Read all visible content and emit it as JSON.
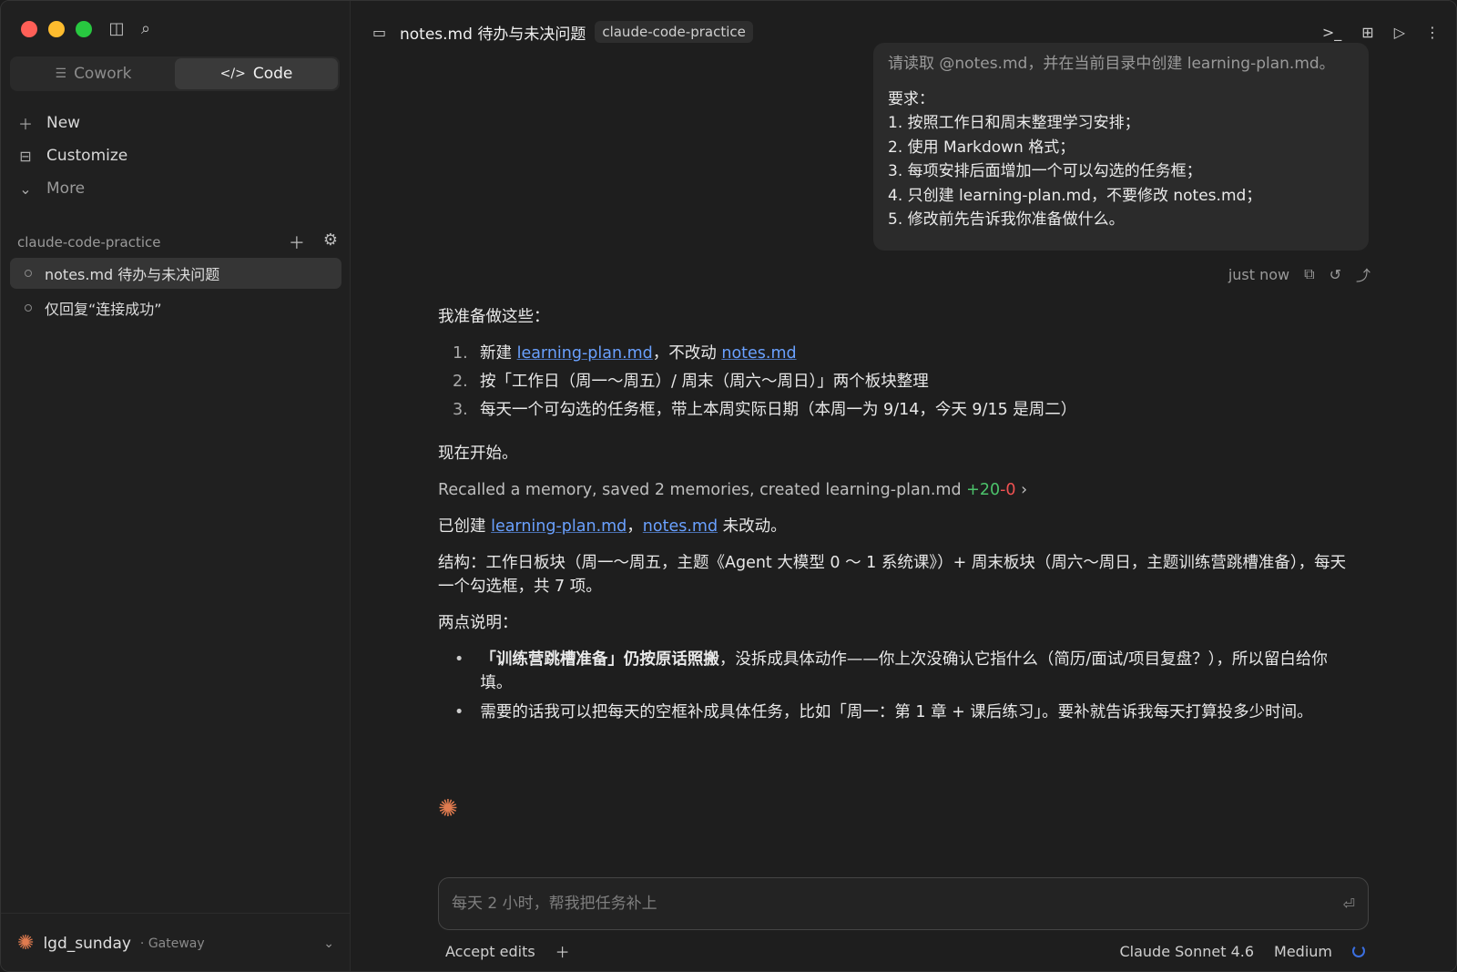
{
  "sidebar": {
    "modes": [
      {
        "label": "Cowork",
        "icon": "list-icon",
        "active": false
      },
      {
        "label": "Code",
        "icon": "code-icon",
        "active": true
      }
    ],
    "nav": [
      {
        "label": "New",
        "icon": "plus-icon"
      },
      {
        "label": "Customize",
        "icon": "briefcase-icon"
      },
      {
        "label": "More",
        "icon": "chevron-down-icon"
      }
    ],
    "project": "claude-code-practice",
    "sessions": [
      {
        "label": "notes.md 待办与未决问题",
        "active": true
      },
      {
        "label": "仅回复“连接成功”",
        "active": false
      }
    ],
    "user": {
      "name": "lgd_sunday",
      "sub": "· Gateway"
    }
  },
  "topbar": {
    "title": "notes.md 待办与未决问题",
    "badge": "claude-code-practice"
  },
  "user_message": {
    "faded": "请读取 @notes.md，并在当前目录中创建 learning-plan.md。",
    "lines": [
      "要求：",
      "1. 按照工作日和周末整理学习安排；",
      "2. 使用 Markdown 格式；",
      "3. 每项安排后面增加一个可以勾选的任务框；",
      "4. 只创建 learning-plan.md，不要修改 notes.md；",
      "5. 修改前先告诉我你准备做什么。"
    ]
  },
  "meta": {
    "time": "just now"
  },
  "reply": {
    "intro": "我准备做这些：",
    "plan": {
      "n1": "1.",
      "n2": "2.",
      "n3": "3.",
      "i1a": "新建 ",
      "i1link1": "learning-plan.md",
      "i1b": "，不改动 ",
      "i1link2": "notes.md",
      "i2": "按「工作日（周一～周五）/ 周末（周六～周日）」两个板块整理",
      "i3": "每天一个可勾选的任务框，带上本周实际日期（本周一为 9/14，今天 9/15 是周二）"
    },
    "start": "现在开始。",
    "tool": {
      "text": "Recalled a memory, saved 2 memories, created learning-plan.md",
      "added": "+20",
      "removed": "-0",
      "chevron": "›"
    },
    "created": {
      "a": "已创建 ",
      "link1": "learning-plan.md",
      "b": "，",
      "link2": "notes.md",
      "c": " 未改动。"
    },
    "structure": "结构：工作日板块（周一～周五，主题《Agent 大模型 0 ～ 1 系统课》）+ 周末板块（周六～周日，主题训练营跳槽准备），每天一个勾选框，共 7 项。",
    "notes_title": "两点说明：",
    "bullets": {
      "b1strong": "「训练营跳槽准备」仍按原话照搬",
      "b1rest": "，没拆成具体动作——你上次没确认它指什么（简历/面试/项目复盘？），所以留白给你填。",
      "b2": "需要的话我可以把每天的空框补成具体任务，比如「周一：第 1 章 + 课后练习」。要补就告诉我每天打算投多少时间。"
    }
  },
  "composer": {
    "placeholder": "每天 2 小时，帮我把任务补上"
  },
  "footer": {
    "accept": "Accept edits",
    "model": "Claude Sonnet 4.6",
    "effort": "Medium"
  },
  "colors": {
    "accent_link": "#6aa1ff",
    "added": "#4cc36b",
    "removed": "#f05252",
    "spark": "#e07b4f"
  }
}
